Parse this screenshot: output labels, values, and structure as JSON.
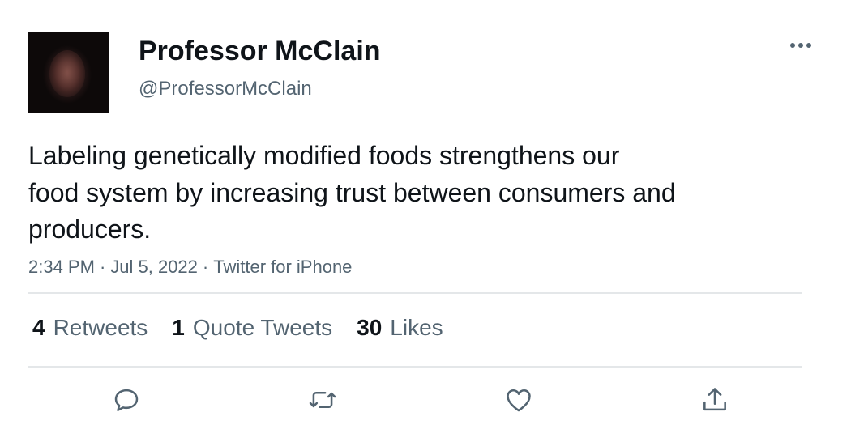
{
  "user": {
    "display_name": "Professor McClain",
    "handle": "@ProfessorMcClain",
    "avatar_icon": "avatar-photo"
  },
  "tweet": {
    "text_lines": [
      "Labeling genetically modified foods strengthens our",
      "food system by increasing trust between consumers and",
      "producers."
    ],
    "time": "2:34 PM",
    "date": "Jul 5, 2022",
    "source": "Twitter for iPhone",
    "separator": "·"
  },
  "stats": {
    "retweets": {
      "count": "4",
      "label": "Retweets"
    },
    "quotes": {
      "count": "1",
      "label": "Quote Tweets"
    },
    "likes": {
      "count": "30",
      "label": "Likes"
    }
  },
  "actions": {
    "reply_icon": "reply-icon",
    "retweet_icon": "retweet-icon",
    "like_icon": "heart-icon",
    "share_icon": "share-icon"
  },
  "colors": {
    "text_primary": "#0f1419",
    "text_secondary": "#536471",
    "divider": "#e4e7e9"
  }
}
